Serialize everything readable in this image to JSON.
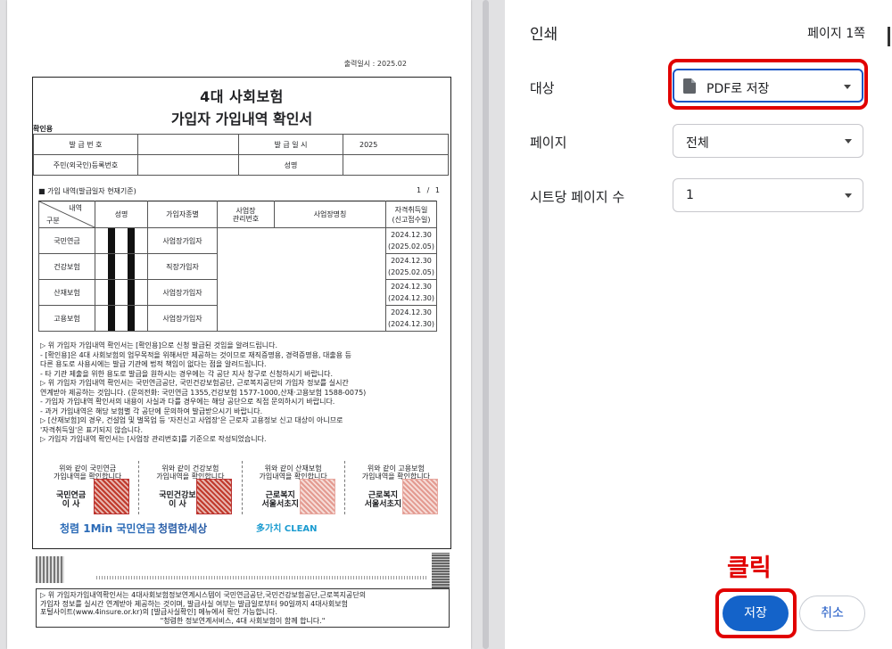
{
  "document": {
    "print_date": "출력일시 : 2025.02",
    "title_line1": "4대 사회보험",
    "title_line2": "가입자 가입내역 확인서",
    "stamp_label": "확인용",
    "info": {
      "issue_no_label": "발 급 번 호",
      "issue_date_label": "발 급 일 시",
      "issue_date_value": "2025",
      "rrn_label": "주민(외국인)등록번호",
      "name_label": "성명"
    },
    "section_title": "■ 가입 내역(발급일자 현재기준)",
    "section_page": "1 / 1",
    "headers": {
      "diag_top": "내역",
      "diag_bottom": "구분",
      "name": "성명",
      "type": "가입자종별",
      "workplace_no": "사업장\n관리번호",
      "workplace_name": "사업장명칭",
      "date": "자격취득일\n(신고접수일)"
    },
    "rows": [
      {
        "kind": "국민연금",
        "type": "사업장가입자",
        "date": "2024.12.30",
        "reported": "(2025.02.05)"
      },
      {
        "kind": "건강보험",
        "type": "직장가입자",
        "date": "2024.12.30",
        "reported": "(2025.02.05)"
      },
      {
        "kind": "산재보험",
        "type": "사업장가입자",
        "date": "2024.12.30",
        "reported": "(2024.12.30)"
      },
      {
        "kind": "고용보험",
        "type": "사업장가입자",
        "date": "2024.12.30",
        "reported": "(2024.12.30)"
      }
    ],
    "notes": [
      "▷ 위 가입자 가입내역 확인서는 [확인용]으로 신청 발급된 것임을 알려드립니다.",
      " - [확인용]은 4대 사회보험의 업무목적을 위해서만 제공하는 것이므로 재직증명용, 경력증명용, 대출용 등",
      "   다른 용도로 사용시에는 발급 기관에 법적 책임이 없다는 점을 알려드립니다.",
      " - 타 기관 제출을 위한 용도로 발급을 원하시는 경우에는 각 공단 지사 창구로 신청하시기 바랍니다.",
      "▷ 위 가입자 가입내역 확인서는 국민연금공단, 국민건강보험공단, 근로복지공단의 가입자 정보를 실시간",
      "  연계받아 제공하는 것입니다. (문의전화: 국민연금 1355,건강보험 1577-1000,산재·고용보험 1588-0075)",
      " - 가입자 가입내역 확인서의 내용이 사실과 다를 경우에는 해당 공단으로 직접 문의하시기 바랍니다.",
      " - 과거 가입내역은 해당 보험별 각 공단에 문의하여 발급받으시기 바랍니다.",
      "▷ [산재보험]의 경우, 건설업 및 벌목업 등 '자진신고 사업장'은 근로자 고용정보 신고 대상이 아니므로",
      "  '자격취득일'은 표기되지 않습니다.",
      "▷ 가입자 가입내역 확인서는 [사업장 관리번호]를 기준으로 작성되었습니다."
    ],
    "seals": [
      {
        "caption": "위와 같이 국민연금\n가입내역을 확인합니다",
        "org": "국민연금\n이 사"
      },
      {
        "caption": "위와 같이 건강보험\n가입내역을 확인합니다",
        "org": "국민건강보\n이 사"
      },
      {
        "caption": "위와 같이 산재보험\n가입내역을 확인합니다",
        "org": "근로복지\n서울서초지"
      },
      {
        "caption": "위와 같이 고용보험\n가입내역을 확인합니다",
        "org": "근로복지\n서울서초지"
      }
    ],
    "logos": [
      "청렴 1Min 국민연금",
      "청렴한세상",
      "多가치 CLEAN"
    ],
    "footer_lines": [
      "▷ 위 가입자가입내역확인서는 4대사회보험정보연계시스템이 국민연금공단,국민건강보험공단,근로복지공단의",
      "  가입자 정보를 실시간 연계받아 제공하는 것이며, 발급사실 여부는 발급일로부터 90일까지 4대사회보험",
      "  포털사이트(www.4insure.or.kr)의 [발급사실확인] 메뉴에서 확인 가능합니다.",
      "\"청렴한 정보연계서비스, 4대 사회보험이 함께 합니다.\""
    ]
  },
  "settings": {
    "title": "인쇄",
    "page_count": "페이지 1쪽",
    "destination_label": "대상",
    "destination_value": "PDF로 저장",
    "pages_label": "페이지",
    "pages_value": "전체",
    "per_sheet_label": "시트당 페이지 수",
    "per_sheet_value": "1",
    "save_button": "저장",
    "cancel_button": "취소",
    "click_annotation": "클릭"
  },
  "colors": {
    "accent": "#1463c9",
    "highlight": "#e10000"
  }
}
